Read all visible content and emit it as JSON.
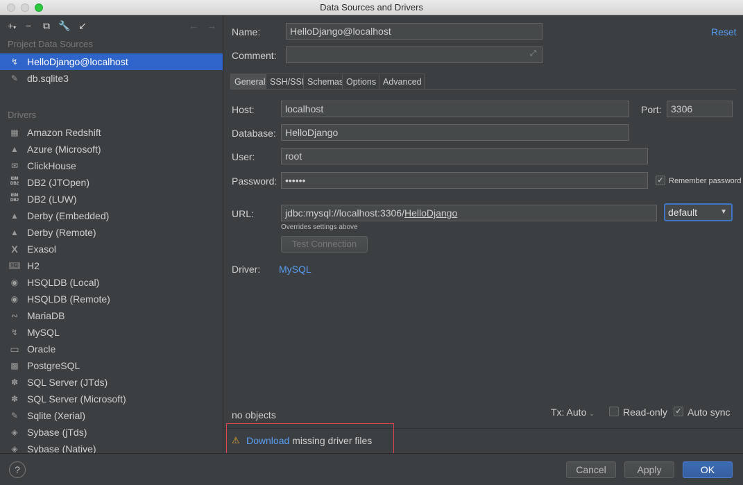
{
  "window": {
    "title": "Data Sources and Drivers"
  },
  "left": {
    "project_header": "Project Data Sources",
    "data_sources": [
      {
        "label": "HelloDjango@localhost",
        "icon": "mysql-dolphin-icon",
        "selected": true
      },
      {
        "label": "db.sqlite3",
        "icon": "sqlite-feather-icon",
        "selected": false
      }
    ],
    "drivers_header": "Drivers",
    "drivers": [
      {
        "label": "Amazon Redshift",
        "icon": "redshift-icon"
      },
      {
        "label": "Azure (Microsoft)",
        "icon": "azure-icon"
      },
      {
        "label": "ClickHouse",
        "icon": "clickhouse-icon"
      },
      {
        "label": "DB2 (JTOpen)",
        "icon": "db2-icon"
      },
      {
        "label": "DB2 (LUW)",
        "icon": "db2-icon"
      },
      {
        "label": "Derby (Embedded)",
        "icon": "derby-hat-icon"
      },
      {
        "label": "Derby (Remote)",
        "icon": "derby-hat-icon"
      },
      {
        "label": "Exasol",
        "icon": "exasol-x-icon"
      },
      {
        "label": "H2",
        "icon": "h2-icon"
      },
      {
        "label": "HSQLDB (Local)",
        "icon": "hsqldb-icon"
      },
      {
        "label": "HSQLDB (Remote)",
        "icon": "hsqldb-icon"
      },
      {
        "label": "MariaDB",
        "icon": "mariadb-seal-icon"
      },
      {
        "label": "MySQL",
        "icon": "mysql-dolphin-icon"
      },
      {
        "label": "Oracle",
        "icon": "oracle-icon"
      },
      {
        "label": "PostgreSQL",
        "icon": "postgresql-elephant-icon"
      },
      {
        "label": "SQL Server (JTds)",
        "icon": "sqlserver-icon"
      },
      {
        "label": "SQL Server (Microsoft)",
        "icon": "sqlserver-icon"
      },
      {
        "label": "Sqlite (Xerial)",
        "icon": "sqlite-feather-icon"
      },
      {
        "label": "Sybase (jTds)",
        "icon": "sybase-icon"
      },
      {
        "label": "Sybase (Native)",
        "icon": "sybase-icon"
      }
    ]
  },
  "form": {
    "name_label": "Name:",
    "name_value": "HelloDjango@localhost",
    "reset_link": "Reset",
    "comment_label": "Comment:",
    "comment_value": "",
    "tabs": [
      "General",
      "SSH/SSL",
      "Schemas",
      "Options",
      "Advanced"
    ],
    "host_label": "Host:",
    "host_value": "localhost",
    "port_label": "Port:",
    "port_value": "3306",
    "database_label": "Database:",
    "database_value": "HelloDjango",
    "user_label": "User:",
    "user_value": "root",
    "password_label": "Password:",
    "password_value": "••••••",
    "remember_label": "Remember password",
    "url_label": "URL:",
    "url_prefix": "jdbc:mysql://localhost:3306/",
    "url_db": "HelloDjango",
    "url_mode": "default",
    "overrides_note": "Overrides settings above",
    "test_button": "Test Connection",
    "driver_label": "Driver:",
    "driver_link": "MySQL",
    "objects_status": "no objects",
    "tx_label": "Tx: Auto",
    "readonly_label": "Read-only",
    "autosync_label": "Auto sync",
    "warning_link": "Download",
    "warning_text": " missing driver files"
  },
  "footer": {
    "help": "?",
    "cancel": "Cancel",
    "apply": "Apply",
    "ok": "OK"
  },
  "colors": {
    "accent": "#2f65ca",
    "link": "#589df6",
    "highlight_box": "#e0454b",
    "warning": "#f0a732"
  }
}
